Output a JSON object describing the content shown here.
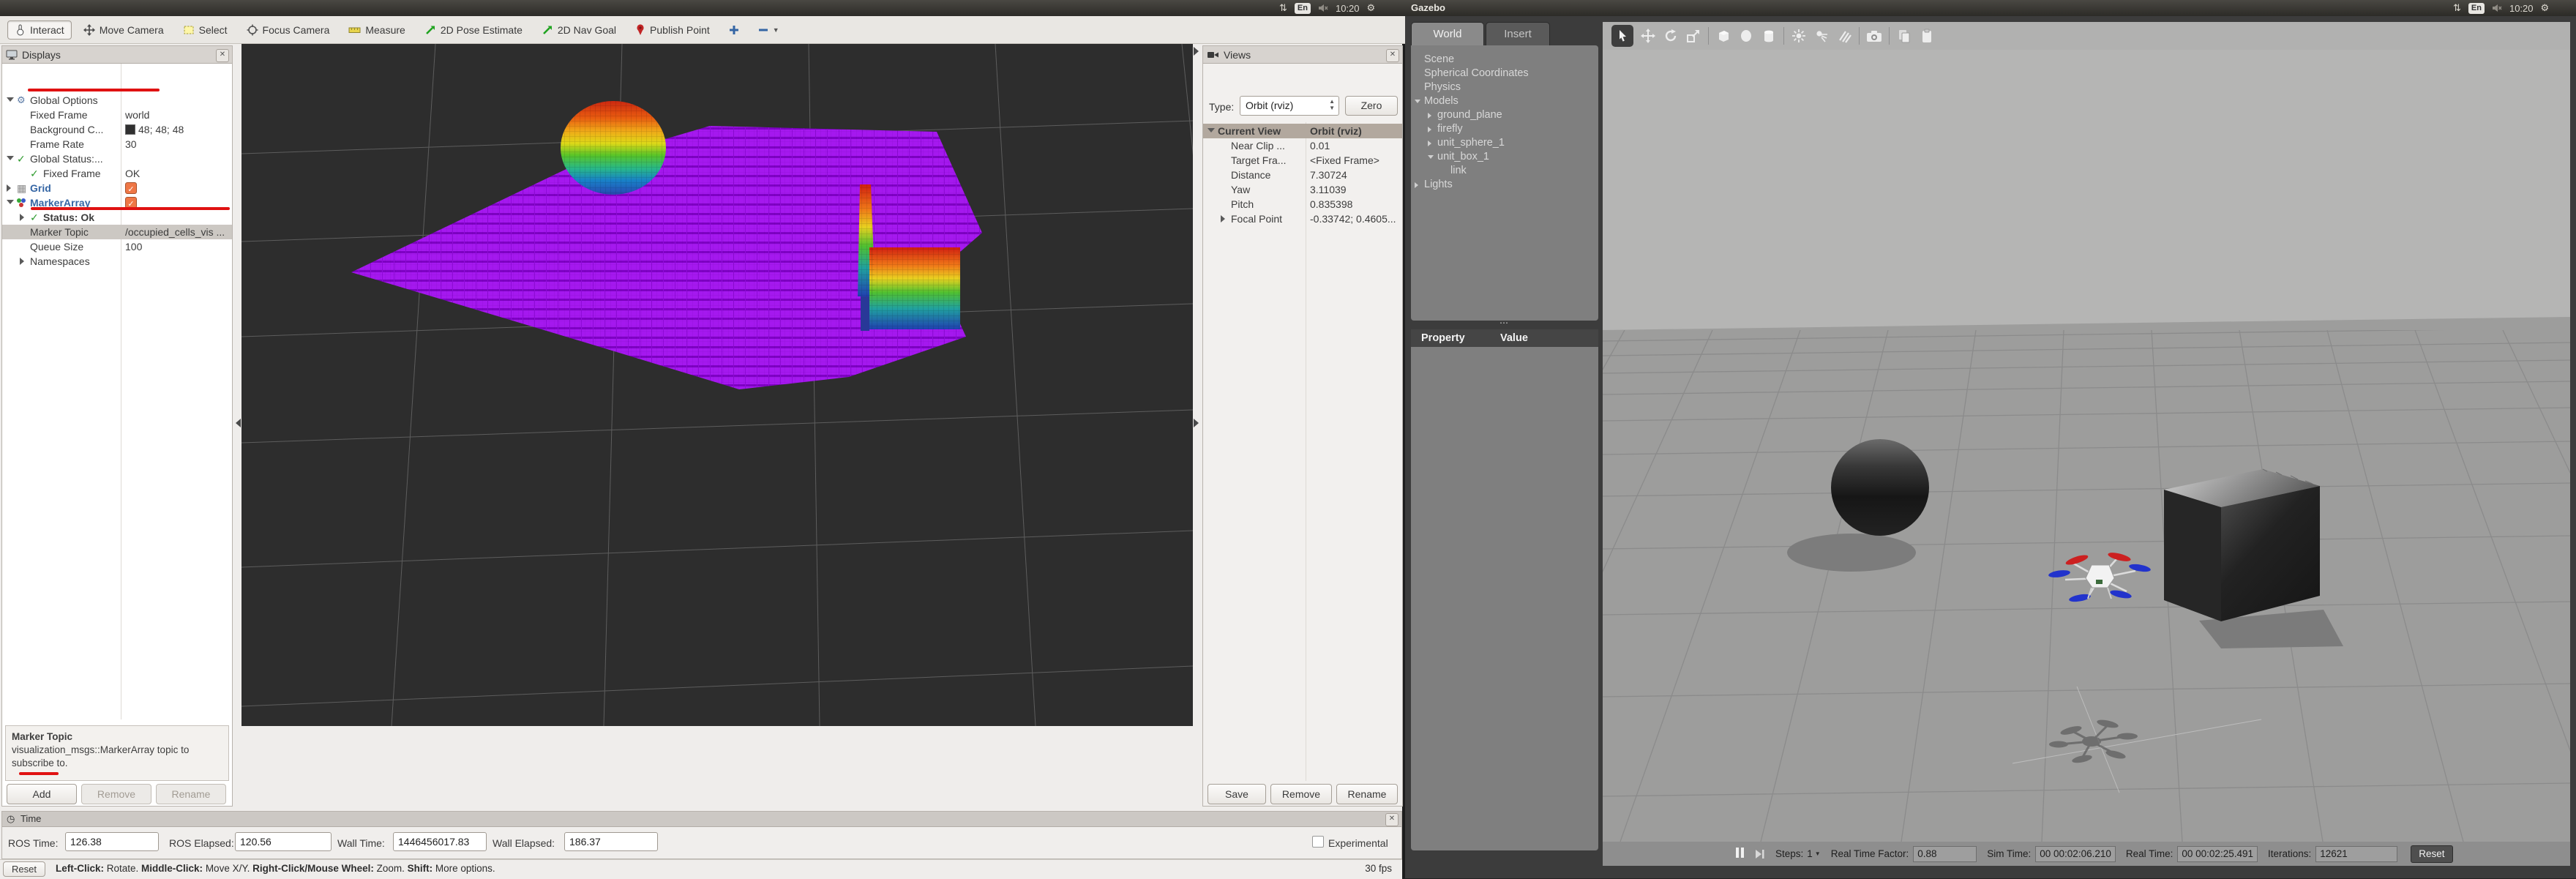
{
  "colors": {
    "annotation_red": "#e01212",
    "rviz_background": "#2d2d2d",
    "octomap_purple": "#a518ef",
    "gazebo_sky": "#b5b5b4",
    "gazebo_ground": "#9d9d9c",
    "rviz_bg_value": "48; 48; 48"
  },
  "top_panel": {
    "keyboard_left": "En",
    "keyboard_right": "En",
    "clock_left": "10:20",
    "clock_right": "10:20",
    "window_title": "Gazebo"
  },
  "rviz": {
    "toolbar": {
      "items": [
        {
          "label": "Interact"
        },
        {
          "label": "Move Camera"
        },
        {
          "label": "Select"
        },
        {
          "label": "Focus Camera"
        },
        {
          "label": "Measure"
        },
        {
          "label": "2D Pose Estimate"
        },
        {
          "label": "2D Nav Goal"
        },
        {
          "label": "Publish Point"
        }
      ]
    },
    "displays": {
      "title": "Displays",
      "rows": [
        {
          "label": "Global Options",
          "value": ""
        },
        {
          "label": "Fixed Frame",
          "value": "world"
        },
        {
          "label": "Background C...",
          "value": "48; 48; 48"
        },
        {
          "label": "Frame Rate",
          "value": "30"
        },
        {
          "label": "Global Status:...",
          "value": ""
        },
        {
          "label": "Fixed Frame",
          "value": "OK"
        },
        {
          "label": "Grid",
          "value": ""
        },
        {
          "label": "MarkerArray",
          "value": ""
        },
        {
          "label": "Status: Ok",
          "value": ""
        },
        {
          "label": "Marker Topic",
          "value": "/occupied_cells_vis ..."
        },
        {
          "label": "Queue Size",
          "value": "100"
        },
        {
          "label": "Namespaces",
          "value": ""
        }
      ],
      "description_title": "Marker Topic",
      "description_body": "visualization_msgs::MarkerArray topic to subscribe to.",
      "buttons": {
        "add": "Add",
        "remove": "Remove",
        "rename": "Rename"
      }
    },
    "views": {
      "title": "Views",
      "type_label": "Type:",
      "type_value": "Orbit (rviz)",
      "zero_button": "Zero",
      "rows": [
        {
          "label": "Current View",
          "value": "Orbit (rviz)"
        },
        {
          "label": "Near Clip ...",
          "value": "0.01"
        },
        {
          "label": "Target Fra...",
          "value": "<Fixed Frame>"
        },
        {
          "label": "Distance",
          "value": "7.30724"
        },
        {
          "label": "Yaw",
          "value": "3.11039"
        },
        {
          "label": "Pitch",
          "value": "0.835398"
        },
        {
          "label": "Focal Point",
          "value": "-0.33742; 0.4605..."
        }
      ],
      "buttons": {
        "save": "Save",
        "remove": "Remove",
        "rename": "Rename"
      }
    },
    "time_panel": {
      "title": "Time",
      "fields": [
        {
          "label": "ROS Time:",
          "value": "126.38"
        },
        {
          "label": "ROS Elapsed:",
          "value": "120.56"
        },
        {
          "label": "Wall Time:",
          "value": "1446456017.83"
        },
        {
          "label": "Wall Elapsed:",
          "value": "186.37"
        }
      ],
      "experimental_label": "Experimental"
    },
    "statusbar": {
      "reset_button": "Reset",
      "seg_bold_1": "Left-Click:",
      "seg_text_1": " Rotate. ",
      "seg_bold_2": "Middle-Click:",
      "seg_text_2": " Move X/Y. ",
      "seg_bold_3": "Right-Click/Mouse Wheel:",
      "seg_text_3": " Zoom. ",
      "seg_bold_4": "Shift:",
      "seg_text_4": " More options.",
      "fps": "30 fps"
    }
  },
  "gazebo": {
    "tabs": {
      "world": "World",
      "insert": "Insert"
    },
    "tree": [
      {
        "label": "Scene"
      },
      {
        "label": "Spherical Coordinates"
      },
      {
        "label": "Physics"
      },
      {
        "label": "Models"
      },
      {
        "label": "ground_plane"
      },
      {
        "label": "firefly"
      },
      {
        "label": "unit_sphere_1"
      },
      {
        "label": "unit_box_1"
      },
      {
        "label": "link"
      },
      {
        "label": "Lights"
      }
    ],
    "property_header": {
      "property": "Property",
      "value": "Value"
    },
    "simbar": {
      "steps_label": "Steps:",
      "steps_value": "1",
      "rtf_label": "Real Time Factor:",
      "rtf_value": "0.88",
      "sim_time_label": "Sim Time:",
      "sim_time_value": "00 00:02:06.210",
      "real_time_label": "Real Time:",
      "real_time_value": "00 00:02:25.491",
      "iterations_label": "Iterations:",
      "iterations_value": "12621",
      "reset_button": "Reset"
    }
  }
}
